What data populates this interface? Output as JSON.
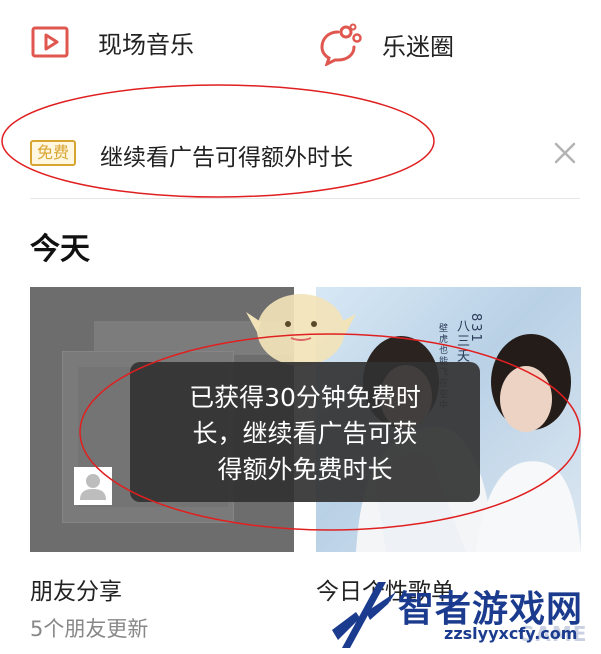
{
  "nav": {
    "live_music": "现场音乐",
    "fan_circle": "乐迷圈"
  },
  "banner": {
    "badge": "免费",
    "text": "继续看广告可得额外时长"
  },
  "section": {
    "title": "今天"
  },
  "cards": [
    {
      "title": "朋友分享",
      "subtitle": "5个朋友更新"
    },
    {
      "title": "今日个性歌单"
    }
  ],
  "album_art": {
    "vertical_lines": [
      "八三夭",
      "831",
      "壁虎也能飞在空中"
    ]
  },
  "toast": {
    "lines": [
      "已获得30分钟免费时",
      "长，继续看广告可获",
      "得额外免费时长"
    ]
  },
  "watermark": {
    "title": "智者游戏网",
    "url": "zzslyyxcfy.com",
    "ghost": "GAME"
  },
  "colors": {
    "accent_red": "#e0574f",
    "badge_gold": "#d9a531",
    "annotation_red": "#e02020",
    "watermark_blue": "#1b3b8f"
  },
  "icons": {
    "live_music": "play-in-box-icon",
    "fan_circle": "speech-bubble-circles-icon",
    "close": "close-x-icon",
    "avatar": "person-icon"
  }
}
